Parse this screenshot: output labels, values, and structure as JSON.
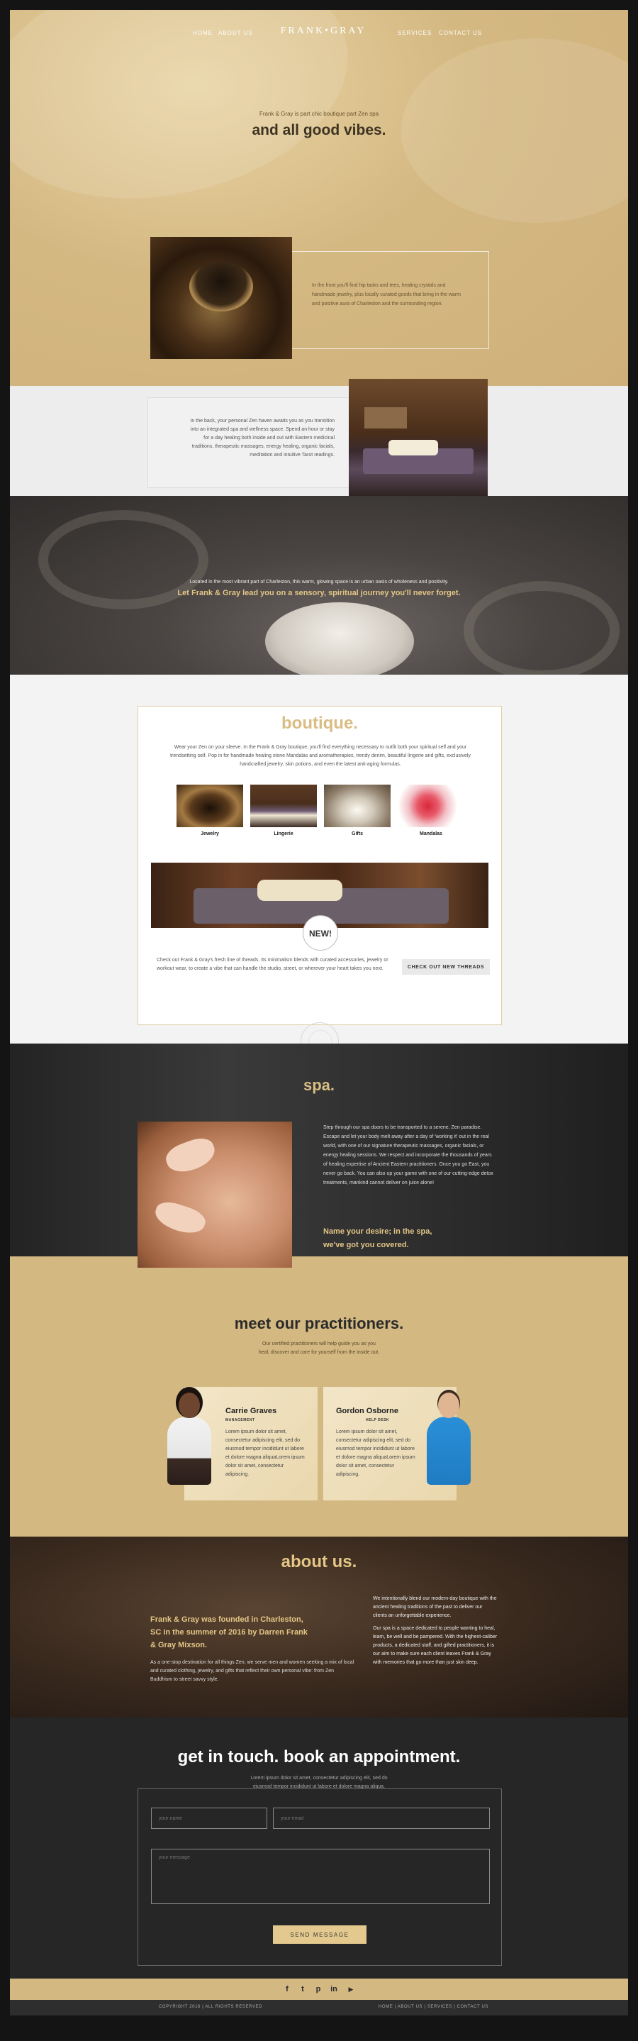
{
  "nav": {
    "home": "HOME",
    "about": "ABOUT US",
    "logo": "FRANK•GRAY",
    "services": "SERVICES",
    "contact": "CONTACT US"
  },
  "hero": {
    "small": "Frank & Gray is part chic boutique part Zen spa",
    "big": "and all good vibes."
  },
  "boutique_intro": {
    "text": "In the front you'll find hip tasks and tees, healing crystals and handmade jewelry, plus locally curated goods that bring in the warm and positive aura of Charleston and the surrounding region."
  },
  "back_room": {
    "text": "In the back, your personal Zen haven awaits you as you transition into an integrated spa and wellness space. Spend an hour or stay for a day healing both inside and out with Eastern medicinal traditions, therapeutic massages, energy healing, organic facials, meditation and intuitive Tarot readings."
  },
  "journey": {
    "small": "Located in the most vibrant part of Charleston, this warm, glowing space is an urban oasis of wholeness and positivity.",
    "big": "Let Frank & Gray lead you on a sensory, spiritual journey you'll never forget."
  },
  "boutique": {
    "title": "boutique.",
    "text": "Wear your Zen on your sleeve. In the Frank & Gray boutique, you'll find everything necessary to outfit both your spiritual self and your trendsetting self. Pop in for handmade healing stone Mandalas and aromatherapies, trendy denim, beautiful lingerie and gifts, exclusively handcrafted jewelry, skin potions, and even the latest anti-aging formulas.",
    "categories": [
      {
        "label": "Jewelry",
        "icon": "singing-bowl-photo"
      },
      {
        "label": "Lingerie",
        "icon": "spa-bed-photo"
      },
      {
        "label": "Gifts",
        "icon": "candles-photo"
      },
      {
        "label": "Mandalas",
        "icon": "flowers-photo"
      }
    ],
    "badge": "NEW!",
    "foot_text": "Check out Frank & Gray's fresh line of threads. Its minimalism blends with curated accessories, jewelry or workout wear, to create a vibe that can handle the studio, street, or wherever your heart takes you next.",
    "button": "CHECK OUT NEW THREADS"
  },
  "spa": {
    "title": "spa.",
    "text": "Step through our spa doors to be transported to a serene, Zen paradise. Escape and let your body melt away after a day of 'working it' out in the real world, with one of our signature therapeutic massages, organic facials, or energy healing sessions. We respect and incorporate the thousands of years of healing expertise of Ancient Eastern practitioners. Once you go East, you never go back. You can also up your game with one of our cutting-edge detox treatments, mankind cannot deliver on juice alone!",
    "gold_line1": "Name your desire; in the spa,",
    "gold_line2": "we've got you covered."
  },
  "practitioners": {
    "title": "meet our practitioners.",
    "sub_line1": "Our certified practitioners will help guide you as you",
    "sub_line2": "heal, discover and care for yourself from the inside out.",
    "people": [
      {
        "name": "Carrie Graves",
        "role": "MANAGEMENT",
        "text": "Lorem ipsum dolor sit amet, consectetur adipiscing elit, sed do eiusmod tempor incididunt ut labore et dolore magna aliquaLorem ipsum dolor sit amet, consectetur adipiscing."
      },
      {
        "name": "Gordon Osborne",
        "role": "HELP DESK",
        "text": "Lorem ipsum dolor sit amet, consectetur adipiscing elit, sed do eiusmod tempor incididunt ut labore et dolore magna aliquaLorem ipsum dolor sit amet, consectetur adipiscing."
      }
    ]
  },
  "about": {
    "title": "about us.",
    "gold": "Frank & Gray was founded in Charleston, SC in the summer of 2016 by Darren Frank & Gray Mixson.",
    "left": "As a one-stop destination for all things Zen, we serve men and women seeking a mix of local and curated clothing, jewelry, and gifts that reflect their own personal vibe: from Zen Buddhism to street savvy style.",
    "right1": "We intentionally blend our modern-day boutique with the ancient healing traditions of the past to deliver our clients an unforgettable experience.",
    "right2": "Our spa is a space dedicated to people wanting to heal, learn, be well and be pampered. With the highest-caliber products, a dedicated staff, and gifted practitioners, it is our aim to make sure each client leaves Frank & Gray with memories that go more than just skin deep."
  },
  "contact": {
    "title": "get in touch. book an appointment.",
    "sub_line1": "Lorem ipsum dolor sit amet, consectetur adipiscing elit, sed do",
    "sub_line2": "eiusmod tempor incididunt ut labore et dolore magna aliqua.",
    "name_placeholder": "your name",
    "email_placeholder": "your email",
    "message_placeholder": "your message",
    "send": "SEND MESSAGE"
  },
  "social": {
    "facebook": "f",
    "twitter": "t",
    "pinterest": "p",
    "linkedin": "in",
    "youtube": "▶"
  },
  "footer": {
    "copyright": "COPYRIGHT 2016 | ALL RIGHTS RESERVED",
    "links": "HOME | ABOUT US | SERVICES | CONTACT US"
  },
  "colors": {
    "gold": "#d4b882",
    "gold_text": "#e4c686",
    "dark": "#262626"
  }
}
